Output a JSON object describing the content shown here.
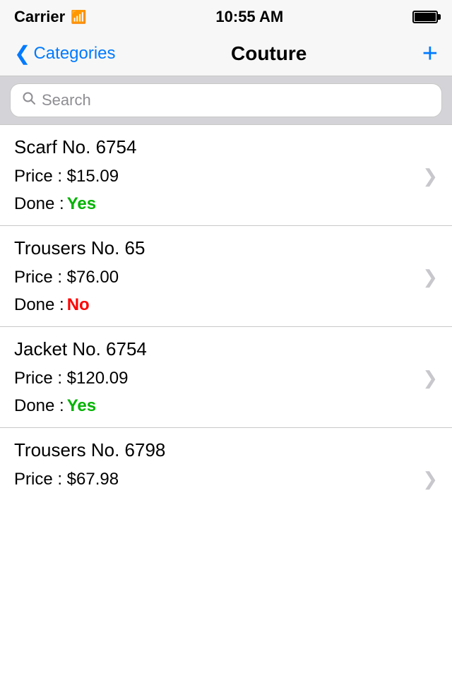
{
  "statusBar": {
    "carrier": "Carrier",
    "time": "10:55 AM"
  },
  "navBar": {
    "backLabel": "Categories",
    "title": "Couture",
    "addButton": "+"
  },
  "search": {
    "placeholder": "Search"
  },
  "items": [
    {
      "name": "Scarf No. 6754",
      "priceLabel": "Price : $15.09",
      "doneLabel": "Done :",
      "doneValue": "Yes",
      "doneStatus": "yes"
    },
    {
      "name": "Trousers No. 65",
      "priceLabel": "Price : $76.00",
      "doneLabel": "Done :",
      "doneValue": "No",
      "doneStatus": "no"
    },
    {
      "name": "Jacket No. 6754",
      "priceLabel": "Price : $120.09",
      "doneLabel": "Done :",
      "doneValue": "Yes",
      "doneStatus": "yes"
    },
    {
      "name": "Trousers No. 6798",
      "priceLabel": "Price : $67.98",
      "doneLabel": "Done :",
      "doneValue": null,
      "doneStatus": null
    }
  ],
  "colors": {
    "blue": "#007aff",
    "green": "#00b300",
    "red": "#ff0000"
  }
}
